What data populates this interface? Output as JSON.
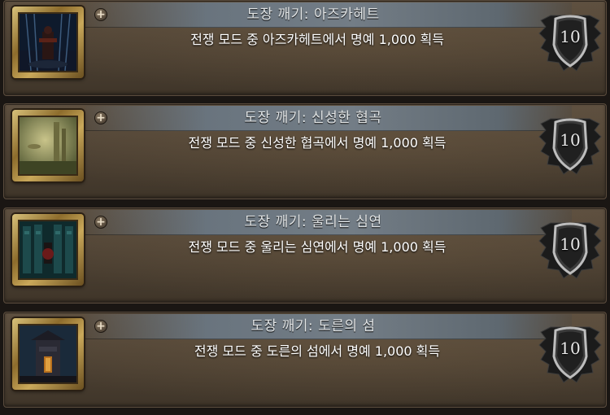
{
  "achievements": [
    {
      "title": "도장 깨기: 아즈카헤트",
      "description": "전쟁 모드 중 아즈카헤트에서 명예 1,000 획득",
      "points": "10",
      "icon": "azjkahet-arena-icon"
    },
    {
      "title": "도장 깨기: 신성한 협곡",
      "description": "전쟁 모드 중 신성한 협곡에서 명예 1,000 획득",
      "points": "10",
      "icon": "hallowed-ground-icon"
    },
    {
      "title": "도장 깨기: 울리는 심연",
      "description": "전쟁 모드 중 울리는 심연에서 명예 1,000 획득",
      "points": "10",
      "icon": "echoing-abyss-icon"
    },
    {
      "title": "도장 깨기: 도른의 섬",
      "description": "전쟁 모드 중 도른의 섬에서 명예 1,000 획득",
      "points": "10",
      "icon": "isle-of-dorn-icon"
    }
  ],
  "expand_symbol": "+"
}
